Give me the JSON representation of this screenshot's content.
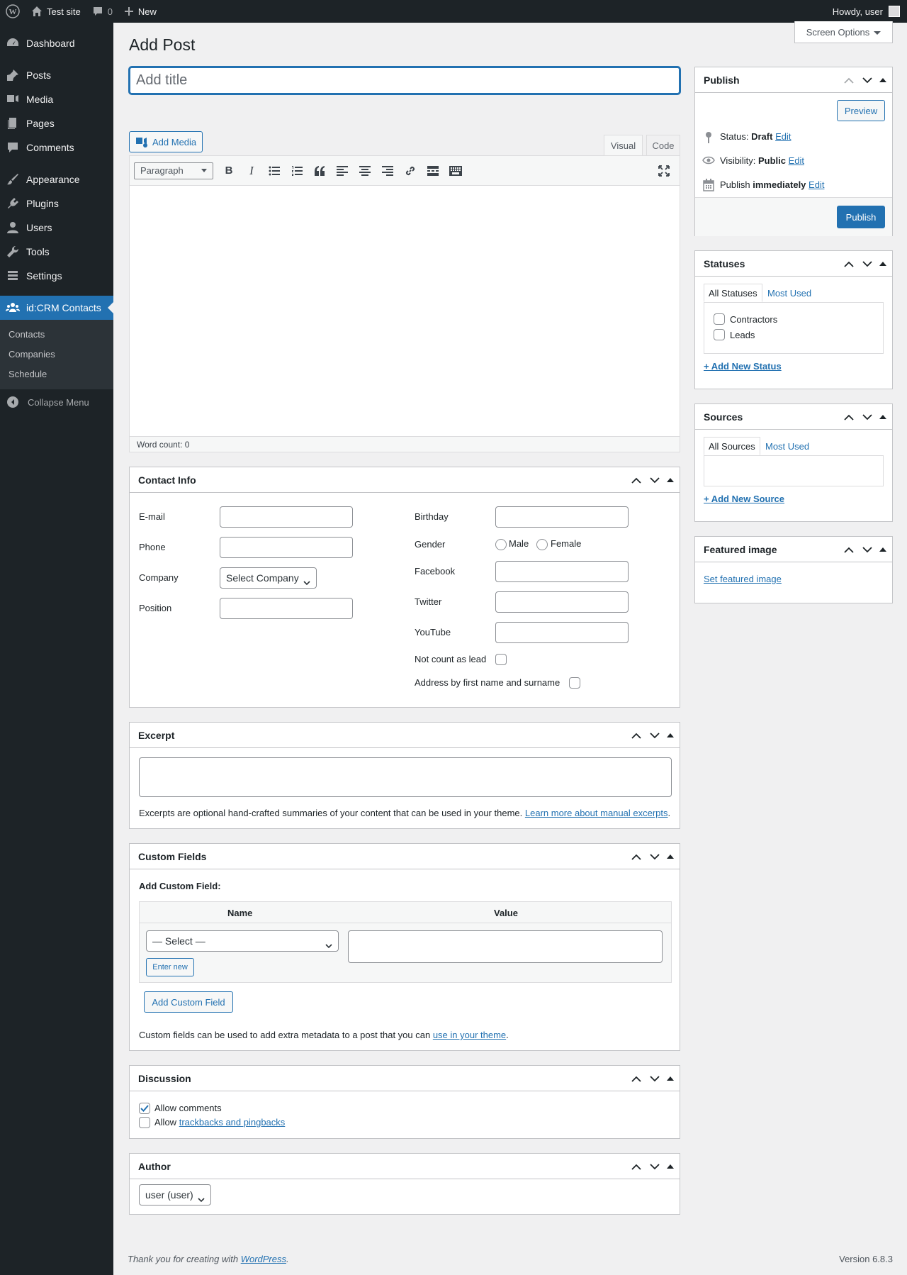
{
  "admin_bar": {
    "site_name": "Test site",
    "comments_count": "0",
    "new_label": "New",
    "howdy": "Howdy, user"
  },
  "sidebar": {
    "items": [
      {
        "label": "Dashboard"
      },
      {
        "label": "Posts"
      },
      {
        "label": "Media"
      },
      {
        "label": "Pages"
      },
      {
        "label": "Comments"
      },
      {
        "label": "Appearance"
      },
      {
        "label": "Plugins"
      },
      {
        "label": "Users"
      },
      {
        "label": "Tools"
      },
      {
        "label": "Settings"
      },
      {
        "label": "id:CRM Contacts"
      }
    ],
    "submenu": [
      "Contacts",
      "Companies",
      "Schedule"
    ],
    "collapse": "Collapse Menu"
  },
  "screen_options": "Screen Options",
  "page_title": "Add Post",
  "title_placeholder": "Add title",
  "editor": {
    "add_media": "Add Media",
    "tab_visual": "Visual",
    "tab_code": "Code",
    "format": "Paragraph",
    "word_count": "Word count: 0"
  },
  "contact_info": {
    "title": "Contact Info",
    "email": "E-mail",
    "phone": "Phone",
    "company": "Company",
    "company_select": "Select Company",
    "position": "Position",
    "birthday": "Birthday",
    "gender": "Gender",
    "male": "Male",
    "female": "Female",
    "facebook": "Facebook",
    "twitter": "Twitter",
    "youtube": "YouTube",
    "not_lead": "Not count as lead",
    "address_by": "Address by first name and surname"
  },
  "excerpt": {
    "title": "Excerpt",
    "help": "Excerpts are optional hand-crafted summaries of your content that can be used in your theme.",
    "link": "Learn more about manual excerpts",
    "end": "."
  },
  "custom_fields": {
    "title": "Custom Fields",
    "add_label": "Add Custom Field:",
    "col_name": "Name",
    "col_value": "Value",
    "select": "— Select —",
    "enter_new": "Enter new",
    "add_button": "Add Custom Field",
    "help": "Custom fields can be used to add extra metadata to a post that you can",
    "link": "use in your theme",
    "end": "."
  },
  "discussion": {
    "title": "Discussion",
    "allow_comments": "Allow comments",
    "allow": "Allow",
    "trackbacks": "trackbacks and pingbacks"
  },
  "author": {
    "title": "Author",
    "value": "user (user)"
  },
  "publish": {
    "title": "Publish",
    "preview": "Preview",
    "status_label": "Status:",
    "status_value": "Draft",
    "visibility_label": "Visibility:",
    "visibility_value": "Public",
    "publish_label": "Publish",
    "publish_value": "immediately",
    "edit": "Edit",
    "publish_button": "Publish"
  },
  "statuses": {
    "title": "Statuses",
    "tab_all": "All Statuses",
    "tab_most": "Most Used",
    "items": [
      "Contractors",
      "Leads"
    ],
    "add_new": "+ Add New Status"
  },
  "sources": {
    "title": "Sources",
    "tab_all": "All Sources",
    "tab_most": "Most Used",
    "add_new": "+ Add New Source"
  },
  "featured_image": {
    "title": "Featured image",
    "link": "Set featured image"
  },
  "footer": {
    "thanks": "Thank you for creating with",
    "wp_link": "WordPress",
    "end": ".",
    "version": "Version 6.8.3"
  }
}
